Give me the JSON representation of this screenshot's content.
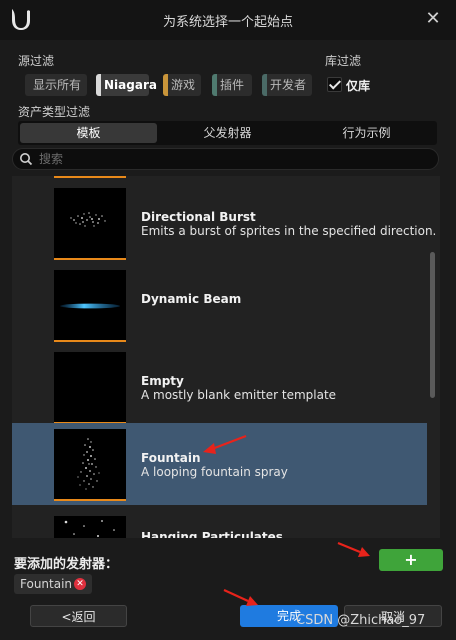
{
  "window": {
    "title": "为系统选择一个起始点"
  },
  "source_filter": {
    "label": "源过滤",
    "chips": [
      {
        "label": "显示所有",
        "active": false,
        "color": ""
      },
      {
        "label": "Niagara",
        "active": true,
        "color": "#d9d9d9"
      },
      {
        "label": "游戏",
        "active": false,
        "color": "#c9953a"
      },
      {
        "label": "插件",
        "active": false,
        "color": "#4f7a6f"
      },
      {
        "label": "开发者",
        "active": false,
        "color": "#4a6a66"
      }
    ]
  },
  "library_filter": {
    "label": "库过滤",
    "checkbox_label": "仅库",
    "checked": true
  },
  "asset_type_filter": {
    "label": "资产类型过滤",
    "tabs": [
      {
        "label": "模板",
        "active": true
      },
      {
        "label": "父发射器",
        "active": false
      },
      {
        "label": "行为示例",
        "active": false
      }
    ]
  },
  "search": {
    "placeholder": "搜索",
    "value": ""
  },
  "emitters": [
    {
      "name": "",
      "desc": "",
      "selected": false
    },
    {
      "name": "Directional Burst",
      "desc": "Emits a burst of sprites in the specified direction.",
      "selected": false
    },
    {
      "name": "Dynamic Beam",
      "desc": "",
      "selected": false
    },
    {
      "name": "Empty",
      "desc": "A mostly blank emitter template",
      "selected": false
    },
    {
      "name": "Fountain",
      "desc": "A looping fountain spray",
      "selected": true
    },
    {
      "name": "Hanging Particulates",
      "desc": "",
      "selected": false
    }
  ],
  "footer": {
    "add_label": "要添加的发射器：",
    "add_button": "+",
    "selected_tag": "Fountain",
    "back_button": "<返回",
    "done_button": "完成",
    "cancel_button": "取消"
  },
  "watermark": "CSDN @Zhichao_97",
  "colors": {
    "accent_blue": "#1f7be0",
    "add_green": "#3fa43a",
    "selection": "#3f5872",
    "thumb_underline": "#e8891a",
    "arrow_red": "#e8231b"
  }
}
